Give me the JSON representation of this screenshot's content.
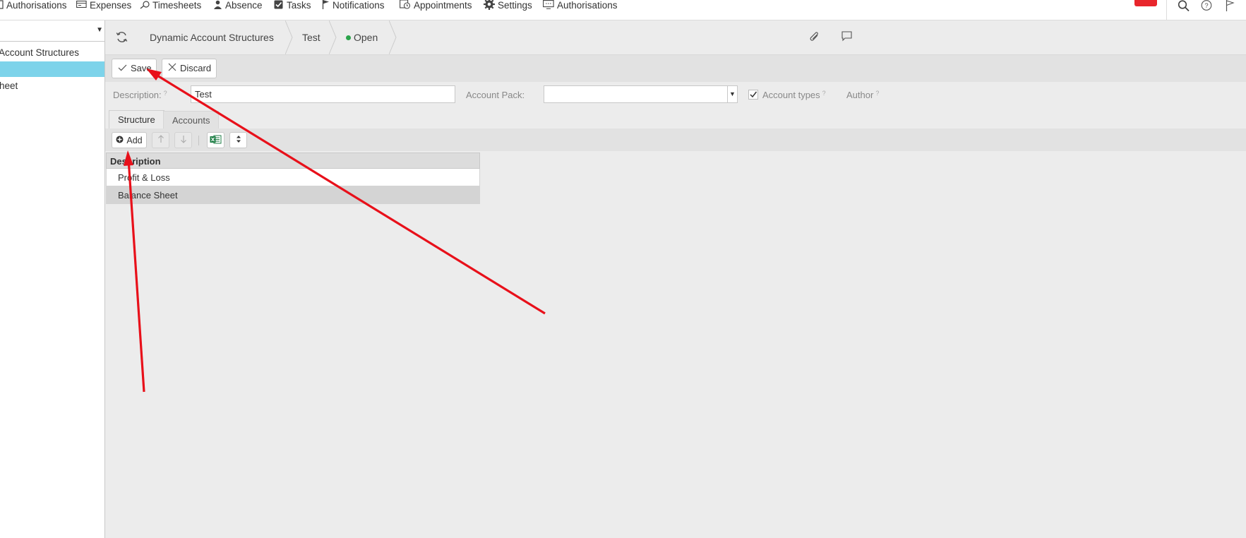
{
  "topnav": {
    "items": [
      {
        "label": "Authorisations",
        "icon": "clipboard-icon"
      },
      {
        "label": "Expenses",
        "icon": "credit-card-icon"
      },
      {
        "label": "Timesheets",
        "icon": "timesheet-icon"
      },
      {
        "label": "Absence",
        "icon": "person-icon"
      },
      {
        "label": "Tasks",
        "icon": "checkbox-icon"
      },
      {
        "label": "Notifications",
        "icon": "flag-icon"
      },
      {
        "label": "Appointments",
        "icon": "calendar-clock-icon"
      },
      {
        "label": "Settings",
        "icon": "gear-icon"
      },
      {
        "label": "Authorisations",
        "icon": "monitor-icon"
      }
    ],
    "right_icons": [
      "search-icon",
      "help-icon",
      "flag-icon"
    ]
  },
  "sidebar": {
    "items": [
      {
        "label": "Account Structures",
        "selected": false
      },
      {
        "label": "",
        "selected": true
      },
      {
        "label": "heet",
        "selected": false
      }
    ]
  },
  "header": {
    "breadcrumbs": [
      "Dynamic Account Structures",
      "Test"
    ],
    "status": {
      "label": "Open",
      "color": "#2aa34a"
    },
    "icons": [
      "refresh-icon",
      "paperclip-icon",
      "comment-icon"
    ]
  },
  "toolbar": {
    "save_label": "Save",
    "discard_label": "Discard"
  },
  "form": {
    "description_label": "Description:",
    "description_value": "Test",
    "account_pack_label": "Account Pack:",
    "account_pack_value": "",
    "account_types_label": "Account types",
    "account_types_checked": true,
    "author_label": "Author",
    "help_mark": "?"
  },
  "tabs": [
    {
      "label": "Structure",
      "active": true
    },
    {
      "label": "Accounts",
      "active": false
    }
  ],
  "grid_toolbar": {
    "add_label": "Add"
  },
  "table": {
    "header": "Description",
    "rows": [
      "Profit & Loss",
      "Balance Sheet"
    ]
  },
  "colors": {
    "accent_selected": "#7dd3ea",
    "annotation_red": "#e8101a",
    "excel_green": "#1e7e45"
  }
}
